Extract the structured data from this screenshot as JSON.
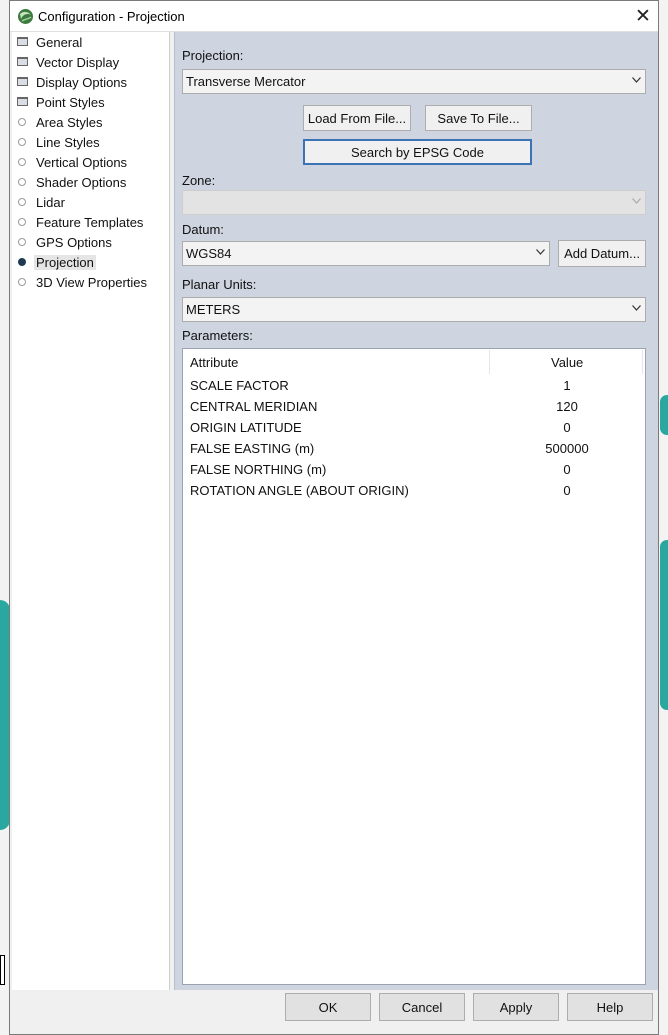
{
  "window": {
    "title": "Configuration - Projection",
    "close_glyph": "✕",
    "icon": "globe-icon"
  },
  "nav": {
    "items": [
      {
        "label": "General",
        "icon": "folder-icon",
        "active": false
      },
      {
        "label": "Vector Display",
        "icon": "folder-icon",
        "active": false
      },
      {
        "label": "Display Options",
        "icon": "folder-icon",
        "active": false
      },
      {
        "label": "Point Styles",
        "icon": "folder-icon",
        "active": false
      },
      {
        "label": "Area Styles",
        "icon": "radio-icon",
        "active": false
      },
      {
        "label": "Line Styles",
        "icon": "radio-icon",
        "active": false
      },
      {
        "label": "Vertical Options",
        "icon": "radio-icon",
        "active": false
      },
      {
        "label": "Shader Options",
        "icon": "radio-icon",
        "active": false
      },
      {
        "label": "Lidar",
        "icon": "radio-icon",
        "active": false
      },
      {
        "label": "Feature Templates",
        "icon": "radio-icon",
        "active": false
      },
      {
        "label": "GPS Options",
        "icon": "radio-icon",
        "active": false
      },
      {
        "label": "Projection",
        "icon": "radio-icon",
        "active": true
      },
      {
        "label": "3D View Properties",
        "icon": "radio-icon",
        "active": false
      }
    ]
  },
  "projection": {
    "label": "Projection:",
    "value": "Transverse Mercator",
    "load_button": "Load From File...",
    "save_button": "Save To File...",
    "epsg_button": "Search by EPSG Code"
  },
  "zone": {
    "label": "Zone:",
    "value": ""
  },
  "datum": {
    "label": "Datum:",
    "value": "WGS84",
    "add_button": "Add Datum..."
  },
  "planar_units": {
    "label": "Planar Units:",
    "value": "METERS"
  },
  "parameters": {
    "label": "Parameters:",
    "columns": [
      "Attribute",
      "Value"
    ],
    "rows": [
      {
        "attribute": "SCALE FACTOR",
        "value": "1"
      },
      {
        "attribute": "CENTRAL MERIDIAN",
        "value": "120"
      },
      {
        "attribute": "ORIGIN LATITUDE",
        "value": "0"
      },
      {
        "attribute": "FALSE EASTING (m)",
        "value": "500000"
      },
      {
        "attribute": "FALSE NORTHING (m)",
        "value": "0"
      },
      {
        "attribute": "ROTATION ANGLE (ABOUT ORIGIN)",
        "value": "0"
      }
    ]
  },
  "footer": {
    "ok": "OK",
    "cancel": "Cancel",
    "apply": "Apply",
    "help": "Help"
  },
  "colors": {
    "pane_bg": "#cfd5e0",
    "focus_border": "#3c73b7",
    "active_radio": "#1e3a52",
    "background_teal": "#2aa8a0"
  }
}
